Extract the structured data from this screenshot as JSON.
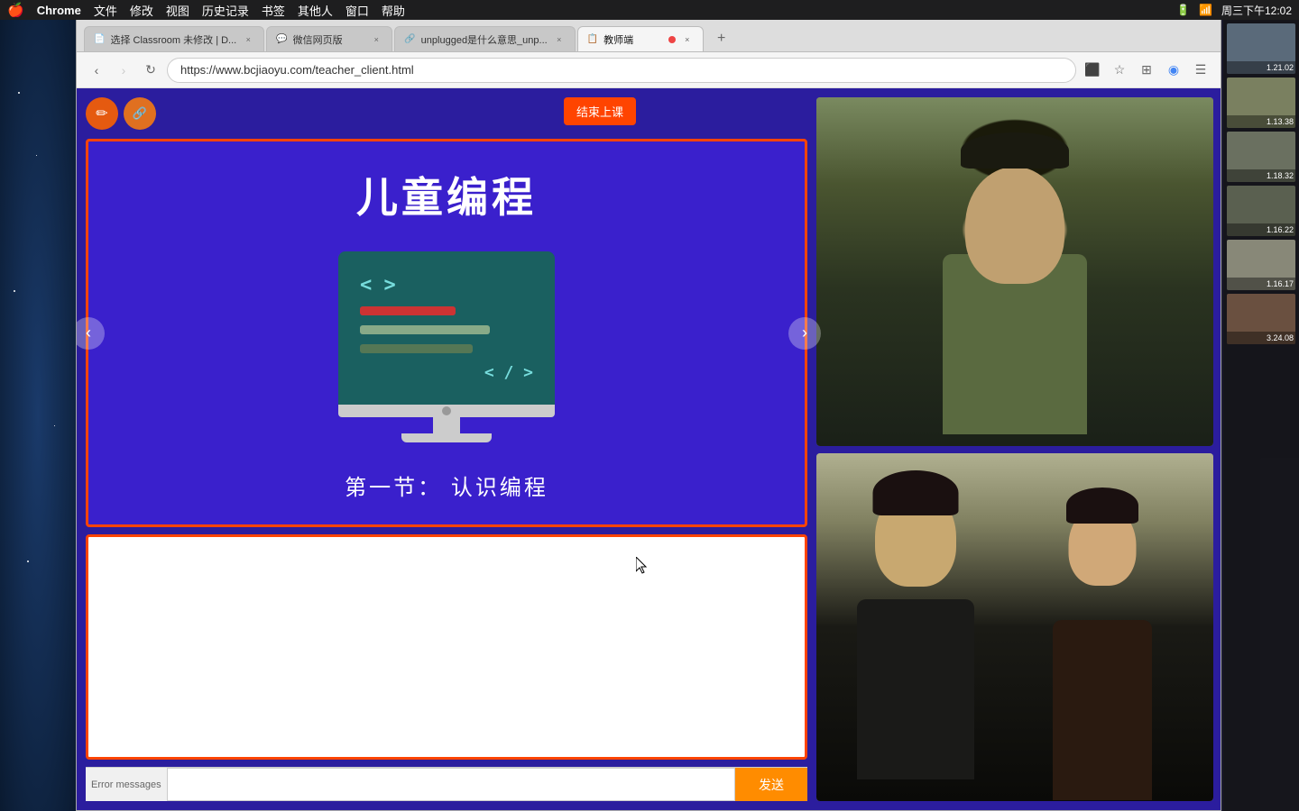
{
  "menubar": {
    "apple": "🍎",
    "app_name": "Chrome",
    "items": [
      "文件",
      "修改",
      "视图",
      "历史记录",
      "书签",
      "其他人",
      "窗口",
      "帮助"
    ],
    "right_items": [
      "100%",
      "周三下午12:02"
    ]
  },
  "browser": {
    "tabs": [
      {
        "id": "tab1",
        "title": "选择 Classroom 未修改 | D...",
        "icon": "📄",
        "active": false,
        "has_close": true
      },
      {
        "id": "tab2",
        "title": "微信网页版",
        "icon": "💬",
        "active": false,
        "has_close": true,
        "color": "#1aad19"
      },
      {
        "id": "tab3",
        "title": "unplugged是什么意思_unp...",
        "icon": "🔗",
        "active": false,
        "has_close": true
      },
      {
        "id": "tab4",
        "title": "教师端",
        "icon": "📋",
        "active": true,
        "has_close": true,
        "recording": true
      }
    ],
    "address": "https://www.bcjiaoyu.com/teacher_client.html"
  },
  "slide": {
    "title": "儿童编程",
    "subtitle": "第一节：  认识编程",
    "nav_prev": "‹",
    "nav_next": "›"
  },
  "toolbar": {
    "btn1_icon": "✏️",
    "btn2_icon": "🔗",
    "end_class": "结束上课"
  },
  "chat": {
    "placeholder": "",
    "send_label": "发送"
  },
  "error": {
    "message": "Error messages"
  },
  "thumbnails": [
    {
      "label": "1.21.02"
    },
    {
      "label": "1.13.38"
    },
    {
      "label": "1.18.32"
    },
    {
      "label": "1.16.22"
    },
    {
      "label": "1.16.17"
    },
    {
      "label": "3.24.08"
    }
  ]
}
